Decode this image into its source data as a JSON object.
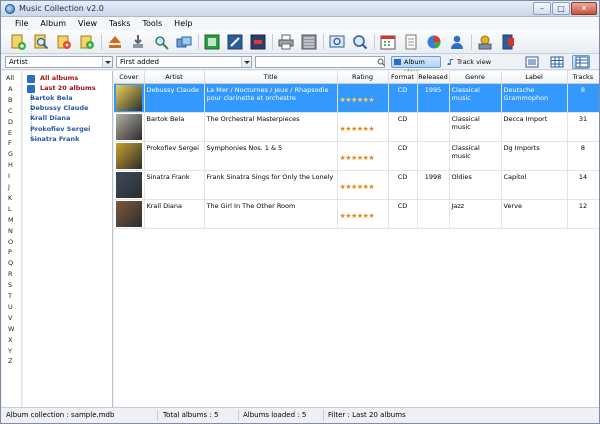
{
  "window": {
    "title": "Music Collection v2.0"
  },
  "menu": [
    "File",
    "Album",
    "View",
    "Tasks",
    "Tools",
    "Help"
  ],
  "toolbar": {
    "groups": [
      [
        "add-album-icon",
        "search-album-icon",
        "edit-album-icon",
        "delete-album-icon"
      ],
      [
        "eject-icon",
        "download-icon",
        "find-cover-icon",
        "tools-icon"
      ],
      [
        "export-html-icon",
        "export-edit-icon",
        "export-pdf-icon"
      ],
      [
        "print-icon",
        "report-icon"
      ],
      [
        "fullscreen-icon",
        "zoom-icon"
      ],
      [
        "calendar-icon",
        "notes-icon",
        "statistics-icon",
        "contacts-icon"
      ],
      [
        "loans-icon",
        "exit-icon"
      ]
    ]
  },
  "filters": {
    "field_select": "Artist",
    "sort_select": "First added",
    "search_value": "",
    "album_view_label": "Album view",
    "track_view_label": "Track view"
  },
  "alpha_index": [
    "All",
    "A",
    "B",
    "C",
    "D",
    "E",
    "F",
    "G",
    "H",
    "I",
    "J",
    "K",
    "L",
    "M",
    "N",
    "O",
    "P",
    "Q",
    "R",
    "S",
    "T",
    "U",
    "V",
    "W",
    "X",
    "Y",
    "Z"
  ],
  "tree": {
    "root_all": "All albums",
    "root_last": "Last 20 albums",
    "children": [
      "Bartok Bela",
      "Debussy Claude",
      "Krall Diana",
      "Prokofiev Sergei",
      "Sinatra Frank"
    ]
  },
  "table": {
    "columns": [
      "Cover",
      "Artist",
      "Title",
      "Rating",
      "Format",
      "Released",
      "Genre",
      "Label",
      "Tracks"
    ],
    "rows": [
      {
        "artist": "Debussy Claude",
        "title": "La Mer / Nocturnes / Jeux / Rhapsodie pour clarinette et orchestre",
        "rating": "★★★★★★",
        "format": "CD",
        "released": "1995",
        "genre": "Classical music",
        "label": "Deutsche Grammophon",
        "tracks": "8",
        "selected": true,
        "cover_color": "#e8d25a"
      },
      {
        "artist": "Bartok Bela",
        "title": "The Orchestral Masterpieces",
        "rating": "★★★★★★",
        "format": "CD",
        "released": "",
        "genre": "Classical music",
        "label": "Decca Import",
        "tracks": "31",
        "selected": false,
        "cover_color": "#b5b0a8"
      },
      {
        "artist": "Prokofiev Sergei",
        "title": "Symphonies Nos. 1 & 5",
        "rating": "★★★★★★",
        "format": "CD",
        "released": "",
        "genre": "Classical music",
        "label": "Dg Imports",
        "tracks": "8",
        "selected": false,
        "cover_color": "#c7a12c"
      },
      {
        "artist": "Sinatra Frank",
        "title": "Frank Sinatra Sings for Only the Lonely",
        "rating": "★★★★★★",
        "format": "CD",
        "released": "1998",
        "genre": "Oldies",
        "label": "Capitol",
        "tracks": "14",
        "selected": false,
        "cover_color": "#3a4a5a"
      },
      {
        "artist": "Krall Diana",
        "title": "The Girl In The Other Room",
        "rating": "★★★★★★",
        "format": "CD",
        "released": "",
        "genre": "Jazz",
        "label": "Verve",
        "tracks": "12",
        "selected": false,
        "cover_color": "#7a5a3a"
      }
    ]
  },
  "status": {
    "collection": "Album collection : sample.mdb",
    "total": "Total albums : 5",
    "loaded": "Albums loaded : 5",
    "filter": "Filter : Last 20 albums"
  }
}
